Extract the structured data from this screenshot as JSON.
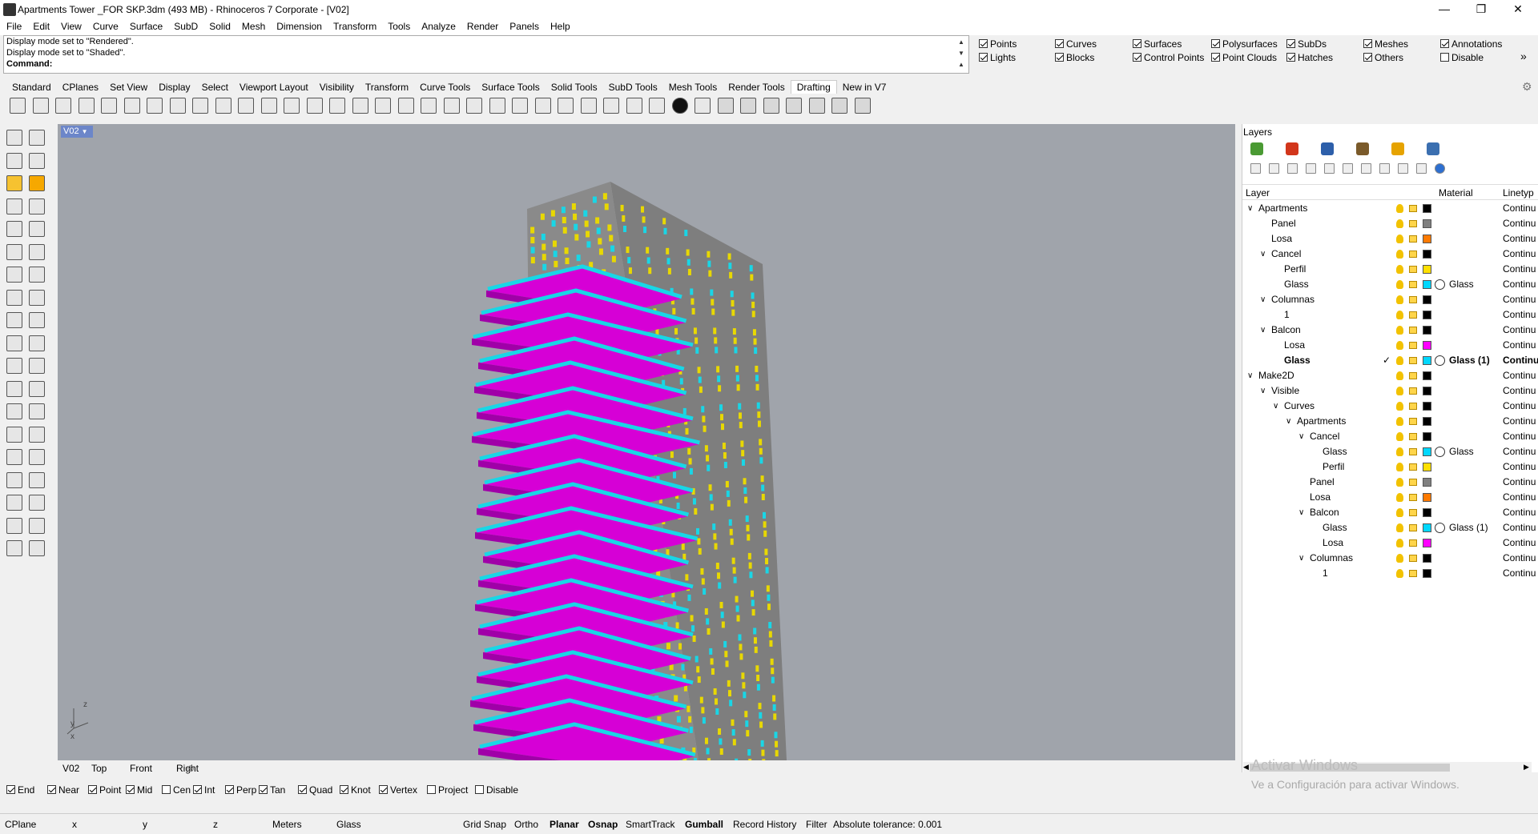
{
  "window": {
    "title": "Apartments Tower _FOR SKP.3dm (493 MB) - Rhinoceros 7 Corporate - [V02]"
  },
  "menu": [
    "File",
    "Edit",
    "View",
    "Curve",
    "Surface",
    "SubD",
    "Solid",
    "Mesh",
    "Dimension",
    "Transform",
    "Tools",
    "Analyze",
    "Render",
    "Panels",
    "Help"
  ],
  "command": {
    "history": [
      "Display mode set to \"Rendered\".",
      "Display mode set to \"Shaded\"."
    ],
    "prompt": "Command:"
  },
  "filters": [
    {
      "label": "Points",
      "on": true
    },
    {
      "label": "Lights",
      "on": true
    },
    {
      "label": "Curves",
      "on": true
    },
    {
      "label": "Blocks",
      "on": true
    },
    {
      "label": "Surfaces",
      "on": true
    },
    {
      "label": "Control Points",
      "on": true
    },
    {
      "label": "Polysurfaces",
      "on": true
    },
    {
      "label": "Point Clouds",
      "on": true
    },
    {
      "label": "SubDs",
      "on": true
    },
    {
      "label": "Hatches",
      "on": true
    },
    {
      "label": "Meshes",
      "on": true
    },
    {
      "label": "Others",
      "on": true
    },
    {
      "label": "Annotations",
      "on": true
    },
    {
      "label": "Disable",
      "on": false
    }
  ],
  "tabs": [
    "Standard",
    "CPlanes",
    "Set View",
    "Display",
    "Select",
    "Viewport Layout",
    "Visibility",
    "Transform",
    "Curve Tools",
    "Surface Tools",
    "Solid Tools",
    "SubD Tools",
    "Mesh Tools",
    "Render Tools",
    "Drafting",
    "New in V7"
  ],
  "active_tab": "Drafting",
  "viewport": {
    "name": "V02",
    "view_tabs": [
      "V02",
      "Top",
      "Front",
      "Right"
    ],
    "axes": {
      "x": "x",
      "y": "y",
      "z": "z"
    }
  },
  "osnaps": [
    {
      "label": "End",
      "on": true
    },
    {
      "label": "Near",
      "on": true
    },
    {
      "label": "Point",
      "on": true
    },
    {
      "label": "Mid",
      "on": true
    },
    {
      "label": "Cen",
      "on": false
    },
    {
      "label": "Int",
      "on": true
    },
    {
      "label": "Perp",
      "on": true
    },
    {
      "label": "Tan",
      "on": true
    },
    {
      "label": "Quad",
      "on": true
    },
    {
      "label": "Knot",
      "on": true
    },
    {
      "label": "Vertex",
      "on": true
    },
    {
      "label": "Project",
      "on": false
    },
    {
      "label": "Disable",
      "on": false
    }
  ],
  "status": {
    "cplane": "CPlane",
    "x": "x",
    "y": "y",
    "z": "z",
    "units": "Meters",
    "layer": "Glass",
    "items": [
      "Grid Snap",
      "Ortho",
      "Planar",
      "Osnap",
      "SmartTrack",
      "Gumball",
      "Record History",
      "Filter"
    ],
    "bold_items": [
      "Planar",
      "Osnap",
      "Gumball"
    ],
    "tolerance": "Absolute tolerance: 0.001"
  },
  "layers_panel": {
    "title": "Layers",
    "columns": {
      "layer": "Layer",
      "material": "Material",
      "linetype": "Linetyp"
    },
    "rows": [
      {
        "name": "Apartments",
        "indent": 0,
        "expand": "v",
        "color": "#000000"
      },
      {
        "name": "Panel",
        "indent": 1,
        "color": "#808080"
      },
      {
        "name": "Losa",
        "indent": 1,
        "color": "#ff7a00"
      },
      {
        "name": "Cancel",
        "indent": 1,
        "expand": "v",
        "color": "#000000"
      },
      {
        "name": "Perfil",
        "indent": 2,
        "color": "#ffe000"
      },
      {
        "name": "Glass",
        "indent": 2,
        "color": "#00d8ff",
        "material": "Glass"
      },
      {
        "name": "Columnas",
        "indent": 1,
        "expand": "v",
        "color": "#000000"
      },
      {
        "name": "1",
        "indent": 2,
        "color": "#000000"
      },
      {
        "name": "Balcon",
        "indent": 1,
        "expand": "v",
        "color": "#000000"
      },
      {
        "name": "Losa",
        "indent": 2,
        "color": "#ff00ff"
      },
      {
        "name": "Glass",
        "indent": 2,
        "color": "#00d8ff",
        "material": "Glass (1)",
        "current": true
      },
      {
        "name": "Make2D",
        "indent": 0,
        "expand": "v",
        "color": "#000000"
      },
      {
        "name": "Visible",
        "indent": 1,
        "expand": "v",
        "color": "#000000"
      },
      {
        "name": "Curves",
        "indent": 2,
        "expand": "v",
        "color": "#000000"
      },
      {
        "name": "Apartments",
        "indent": 3,
        "expand": "v",
        "color": "#000000"
      },
      {
        "name": "Cancel",
        "indent": 4,
        "expand": "v",
        "color": "#000000"
      },
      {
        "name": "Glass",
        "indent": 5,
        "color": "#00d8ff",
        "material": "Glass"
      },
      {
        "name": "Perfil",
        "indent": 5,
        "color": "#ffe000"
      },
      {
        "name": "Panel",
        "indent": 4,
        "color": "#808080"
      },
      {
        "name": "Losa",
        "indent": 4,
        "color": "#ff7a00"
      },
      {
        "name": "Balcon",
        "indent": 4,
        "expand": "v",
        "color": "#000000"
      },
      {
        "name": "Glass",
        "indent": 5,
        "color": "#00d8ff",
        "material": "Glass (1)"
      },
      {
        "name": "Losa",
        "indent": 5,
        "color": "#ff00ff"
      },
      {
        "name": "Columnas",
        "indent": 4,
        "expand": "v",
        "color": "#000000"
      },
      {
        "name": "1",
        "indent": 5,
        "color": "#000000"
      }
    ],
    "linetype_value": "Continu"
  },
  "watermark": {
    "line1": "Activar Windows",
    "line2": "Ve a Configuración para activar Windows."
  },
  "colors": {
    "viewport_bg": "#a0a4ab",
    "balcony": "#d600d6",
    "glass": "#19d6e6",
    "tower": "#7d7d7d",
    "window": "#e8d800"
  }
}
